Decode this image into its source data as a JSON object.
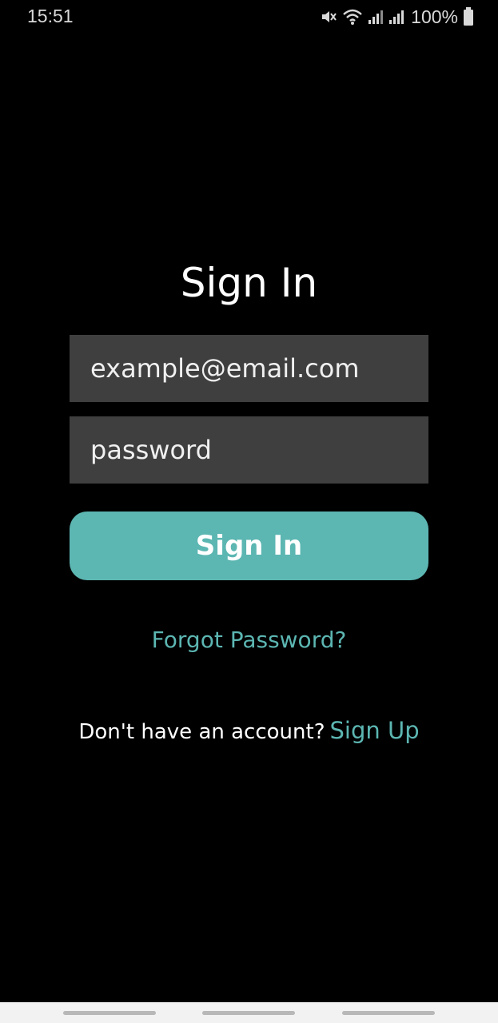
{
  "status_bar": {
    "time": "15:51",
    "battery_percent": "100%",
    "icons": [
      "mute-icon",
      "wifi-icon",
      "signal-icon",
      "signal-icon",
      "battery-icon"
    ]
  },
  "title": "Sign In",
  "email_field": {
    "placeholder": "example@email.com"
  },
  "password_field": {
    "placeholder": "password"
  },
  "signin_button": {
    "label": "Sign In"
  },
  "forgot_link": "Forgot Password?",
  "signup": {
    "prompt": "Don't have an account?",
    "link": "Sign Up"
  },
  "colors": {
    "background": "#000000",
    "accent": "#5cb6b2",
    "field": "#3f3f3f"
  }
}
